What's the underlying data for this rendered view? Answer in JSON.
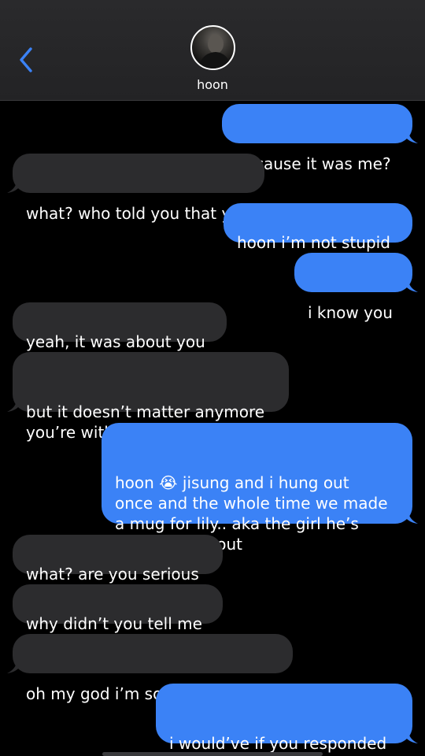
{
  "header": {
    "contact_name": "hoon",
    "back_icon": "chevron-left-icon",
    "accent_color": "#3b82f6"
  },
  "colors": {
    "sent_bubble": "#3b82f6",
    "received_bubble": "#2c2c2e",
    "background": "#000000"
  },
  "messages": [
    {
      "from": "me",
      "text": "because it was me?"
    },
    {
      "from": "them",
      "text": "what? who told you that yn"
    },
    {
      "from": "me",
      "text": "hoon i’m not stupid"
    },
    {
      "from": "me",
      "text": "i know you"
    },
    {
      "from": "them",
      "text": "yeah, it was about you"
    },
    {
      "from": "them",
      "text": "but it doesn’t matter anymore\nyou’re with jisung"
    },
    {
      "from": "me",
      "text": "hoon 😭 jisung and i hung out\nonce and the whole time we made\na mug for lily.. aka the girl he’s\ngoing to ask out"
    },
    {
      "from": "them",
      "text": "what? are you serious"
    },
    {
      "from": "them",
      "text": "why didn’t you tell me"
    },
    {
      "from": "them",
      "text": "oh my god i’m so sorry sweets"
    },
    {
      "from": "me",
      "text": "i would’ve if you responded\nto me :(("
    }
  ]
}
